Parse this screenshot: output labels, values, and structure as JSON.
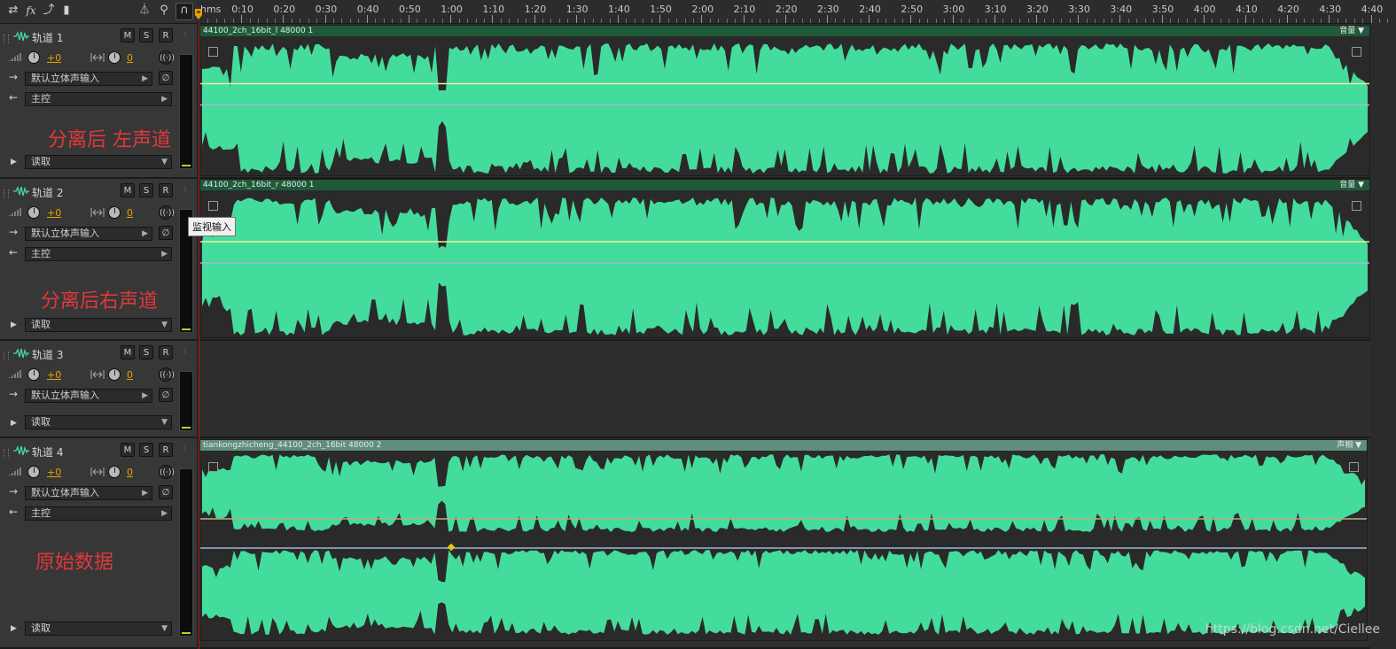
{
  "toolbar": {
    "buttons": [
      {
        "name": "swap-icon",
        "glyph": "⇄"
      },
      {
        "name": "fx-icon",
        "glyph": "fx"
      },
      {
        "name": "send-icon",
        "glyph": "⤴"
      },
      {
        "name": "level-meter-icon",
        "glyph": "▮"
      },
      {
        "name": "metronome-icon",
        "glyph": "⏃"
      },
      {
        "name": "input-monitor-icon",
        "glyph": "⚲"
      },
      {
        "name": "headphones-icon",
        "glyph": "∩"
      }
    ]
  },
  "ruler": {
    "unit_label": "hms",
    "labels": [
      "0:10",
      "0:20",
      "0:30",
      "0:40",
      "0:50",
      "1:00",
      "1:10",
      "1:20",
      "1:30",
      "1:40",
      "1:50",
      "2:00",
      "2:10",
      "2:20",
      "2:30",
      "2:40",
      "2:50",
      "3:00",
      "3:10",
      "3:20",
      "3:30",
      "3:40",
      "3:50",
      "4:00",
      "4:10",
      "4:20",
      "4:30",
      "4:40"
    ]
  },
  "tracks": [
    {
      "name": "轨道 1",
      "volume": "+0",
      "pan": "0",
      "input": "默认立体声输入",
      "output": "主控",
      "automation": "读取",
      "annotation": "分离后 左声道",
      "clip": {
        "title": "44100_2ch_16bit_l 48000 1",
        "right_label": "音量"
      }
    },
    {
      "name": "轨道 2",
      "volume": "+0",
      "pan": "0",
      "input": "默认立体声输入",
      "output": "主控",
      "automation": "读取",
      "annotation": "分离后右声道",
      "clip": {
        "title": "44100_2ch_16bit_r 48000 1",
        "right_label": "音量"
      }
    },
    {
      "name": "轨道 3",
      "volume": "+0",
      "pan": "0",
      "input": "默认立体声输入",
      "output": "",
      "automation": "读取",
      "annotation": "",
      "clip": null
    },
    {
      "name": "轨道 4",
      "volume": "+0",
      "pan": "0",
      "input": "默认立体声输入",
      "output": "主控",
      "automation": "读取",
      "annotation": "原始数据",
      "clip": {
        "title": "tiankongzhicheng_44100_2ch_16bit 48000 2",
        "right_label": "声相"
      }
    }
  ],
  "buttons": {
    "mute": "M",
    "solo": "S",
    "record": "R",
    "input": "I"
  },
  "tooltip": "监视输入",
  "watermark": "https://blog.csdn.net/Ciellee",
  "colors": {
    "waveform": "#44dc9c",
    "clip_title_bar": "#1e5a3a",
    "volume_line": "#f0f0a0",
    "pan_line": "#a0b8d8",
    "annotation_text": "#e0383a",
    "meter_level": "#c8c81e"
  }
}
